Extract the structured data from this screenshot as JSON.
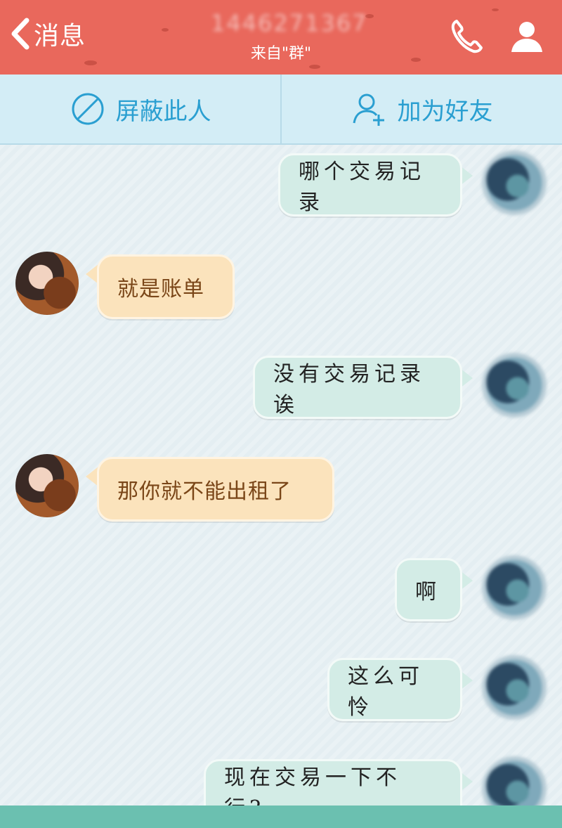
{
  "header": {
    "back_label": "消息",
    "title": "1446271367",
    "subtitle": "来自\"群\"",
    "phone_icon": "phone-icon",
    "contact_icon": "person-icon",
    "bg_color": "#e9685c"
  },
  "actions": {
    "block_label": "屏蔽此人",
    "add_friend_label": "加为好友",
    "accent_color": "#2a9fd1"
  },
  "messages": [
    {
      "from": "me",
      "text": "哪个交易记录"
    },
    {
      "from": "them",
      "text": "就是账单"
    },
    {
      "from": "me",
      "text": "没有交易记录诶"
    },
    {
      "from": "them",
      "text": "那你就不能出租了"
    },
    {
      "from": "me",
      "text": "啊"
    },
    {
      "from": "me",
      "text": "这么可怜"
    },
    {
      "from": "me",
      "text": "现在交易一下不行?"
    }
  ]
}
